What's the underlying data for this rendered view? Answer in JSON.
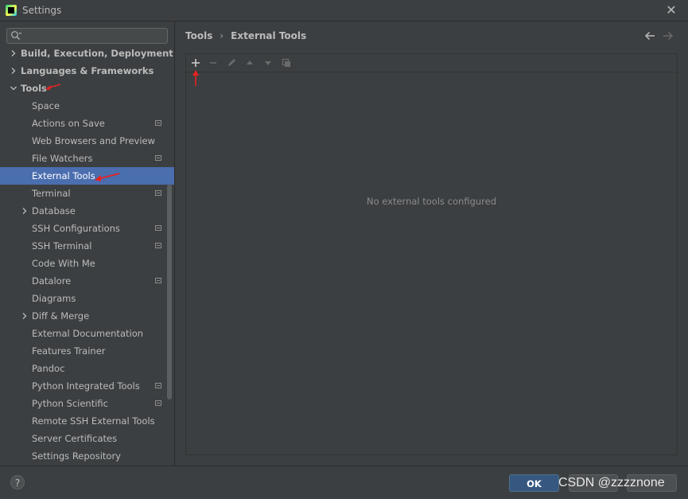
{
  "window": {
    "title": "Settings"
  },
  "sidebar": {
    "search_placeholder": "",
    "items": [
      {
        "label": "Build, Execution, Deployment",
        "level": 0,
        "bold": true,
        "expander": "collapsed",
        "project": false
      },
      {
        "label": "Languages & Frameworks",
        "level": 0,
        "bold": true,
        "expander": "collapsed",
        "project": false
      },
      {
        "label": "Tools",
        "level": 0,
        "bold": true,
        "expander": "expanded",
        "project": false
      },
      {
        "label": "Space",
        "level": 1,
        "bold": false,
        "expander": "none",
        "project": false
      },
      {
        "label": "Actions on Save",
        "level": 1,
        "bold": false,
        "expander": "none",
        "project": true
      },
      {
        "label": "Web Browsers and Preview",
        "level": 1,
        "bold": false,
        "expander": "none",
        "project": false
      },
      {
        "label": "File Watchers",
        "level": 1,
        "bold": false,
        "expander": "none",
        "project": true
      },
      {
        "label": "External Tools",
        "level": 1,
        "bold": false,
        "expander": "none",
        "project": false,
        "selected": true
      },
      {
        "label": "Terminal",
        "level": 1,
        "bold": false,
        "expander": "none",
        "project": true
      },
      {
        "label": "Database",
        "level": 1,
        "bold": false,
        "expander": "collapsed",
        "project": false
      },
      {
        "label": "SSH Configurations",
        "level": 1,
        "bold": false,
        "expander": "none",
        "project": true
      },
      {
        "label": "SSH Terminal",
        "level": 1,
        "bold": false,
        "expander": "none",
        "project": true
      },
      {
        "label": "Code With Me",
        "level": 1,
        "bold": false,
        "expander": "none",
        "project": false
      },
      {
        "label": "Datalore",
        "level": 1,
        "bold": false,
        "expander": "none",
        "project": true
      },
      {
        "label": "Diagrams",
        "level": 1,
        "bold": false,
        "expander": "none",
        "project": false
      },
      {
        "label": "Diff & Merge",
        "level": 1,
        "bold": false,
        "expander": "collapsed",
        "project": false
      },
      {
        "label": "External Documentation",
        "level": 1,
        "bold": false,
        "expander": "none",
        "project": false
      },
      {
        "label": "Features Trainer",
        "level": 1,
        "bold": false,
        "expander": "none",
        "project": false
      },
      {
        "label": "Pandoc",
        "level": 1,
        "bold": false,
        "expander": "none",
        "project": false
      },
      {
        "label": "Python Integrated Tools",
        "level": 1,
        "bold": false,
        "expander": "none",
        "project": true
      },
      {
        "label": "Python Scientific",
        "level": 1,
        "bold": false,
        "expander": "none",
        "project": true
      },
      {
        "label": "Remote SSH External Tools",
        "level": 1,
        "bold": false,
        "expander": "none",
        "project": false
      },
      {
        "label": "Server Certificates",
        "level": 1,
        "bold": false,
        "expander": "none",
        "project": false
      },
      {
        "label": "Settings Repository",
        "level": 1,
        "bold": false,
        "expander": "none",
        "project": false
      }
    ]
  },
  "breadcrumb": {
    "parent": "Tools",
    "separator": "›",
    "current": "External Tools"
  },
  "panel": {
    "empty_text": "No external tools configured"
  },
  "footer": {
    "help_label": "?",
    "ok_label": "OK",
    "cancel_label": "",
    "apply_label": "",
    "watermark": "CSDN @zzzznone"
  },
  "colors": {
    "accent": "#4b6eaf",
    "annotation": "#e52222",
    "ok_button": "#365880"
  }
}
